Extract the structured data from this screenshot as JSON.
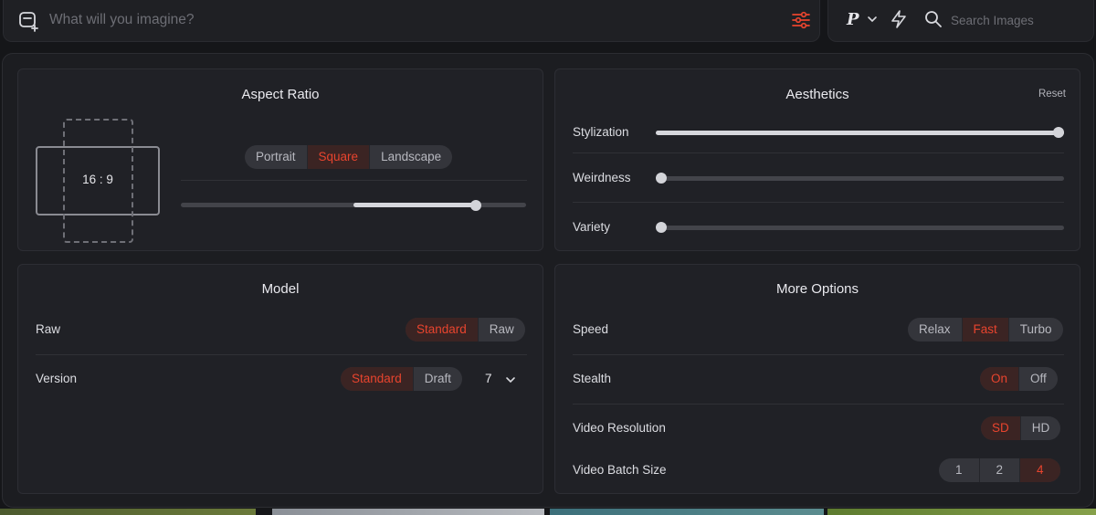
{
  "prompt": {
    "placeholder": "What will you imagine?"
  },
  "toolbar": {
    "personalize_label": "P",
    "search_placeholder": "Search Images"
  },
  "aspect_ratio": {
    "title": "Aspect Ratio",
    "ratio_text": "16 : 9",
    "orientation_options": [
      "Portrait",
      "Square",
      "Landscape"
    ],
    "selected": "Landscape",
    "slider_value": 0.86
  },
  "aesthetics": {
    "title": "Aesthetics",
    "reset_label": "Reset",
    "sliders": [
      {
        "label": "Stylization",
        "value": 1.0
      },
      {
        "label": "Weirdness",
        "value": 0.0
      },
      {
        "label": "Variety",
        "value": 0.0
      }
    ]
  },
  "model": {
    "title": "Model",
    "raw": {
      "label": "Raw",
      "options": [
        "Standard",
        "Raw"
      ],
      "selected": "Standard"
    },
    "version": {
      "label": "Version",
      "options": [
        "Standard",
        "Draft"
      ],
      "selected": "Standard",
      "value": "7"
    }
  },
  "more_options": {
    "title": "More Options",
    "speed": {
      "label": "Speed",
      "options": [
        "Relax",
        "Fast",
        "Turbo"
      ],
      "selected": "Fast"
    },
    "stealth": {
      "label": "Stealth",
      "options": [
        "On",
        "Off"
      ],
      "selected": "On"
    },
    "video_resolution": {
      "label": "Video Resolution",
      "options": [
        "SD",
        "HD"
      ],
      "selected": "SD"
    },
    "video_batch_size": {
      "label": "Video Batch Size",
      "options": [
        "1",
        "2",
        "4"
      ],
      "selected": "4"
    }
  },
  "colors": {
    "accent": "#e8442e",
    "active_bg": "#3b2423",
    "panel": "#1c1d21",
    "card": "#202126"
  },
  "icons": [
    "new-prompt-icon",
    "settings-sliders-icon",
    "chevron-down-icon",
    "bolt-icon",
    "search-icon"
  ]
}
